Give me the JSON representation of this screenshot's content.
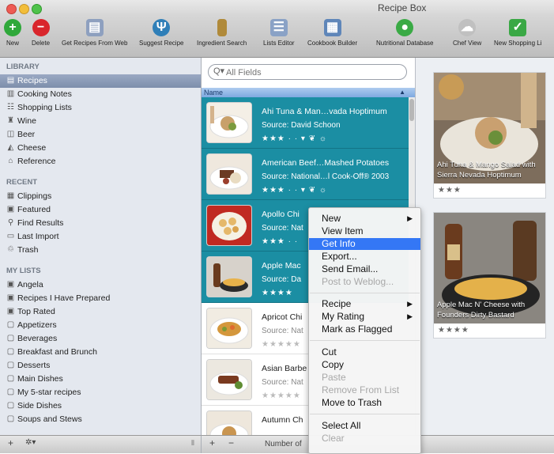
{
  "window": {
    "title": "Recipe Box"
  },
  "toolbar": {
    "items": [
      {
        "label": "New",
        "icon": "plus-circle-icon",
        "color": "#2fa83a"
      },
      {
        "label": "Delete",
        "icon": "minus-circle-icon",
        "color": "#d9262c"
      },
      {
        "label": "Get Recipes From Web",
        "icon": "web-icon",
        "color": "#8ea0bf"
      },
      {
        "label": "Suggest Recipe",
        "icon": "fork-knife-icon",
        "color": "#2f7fb8"
      },
      {
        "label": "Ingredient Search",
        "icon": "bottle-icon",
        "color": "#b08a3a"
      },
      {
        "label": "Lists Editor",
        "icon": "lists-icon",
        "color": "#8aa2c6"
      },
      {
        "label": "Cookbook Builder",
        "icon": "cookbook-icon",
        "color": "#5f86b9"
      },
      {
        "label": "Nutritional Database",
        "icon": "nutrition-icon",
        "color": "#3aaa45"
      },
      {
        "label": "Chef View",
        "icon": "chef-hat-icon",
        "color": "#c0c0c0"
      },
      {
        "label": "New Shopping Li",
        "icon": "shopping-list-icon",
        "color": "#3aa845"
      }
    ]
  },
  "sidebar": {
    "library_title": "LIBRARY",
    "library": [
      {
        "label": "Recipes",
        "icon": "recipes-icon"
      },
      {
        "label": "Cooking Notes",
        "icon": "notes-icon"
      },
      {
        "label": "Shopping Lists",
        "icon": "shopping-icon"
      },
      {
        "label": "Wine",
        "icon": "wine-icon"
      },
      {
        "label": "Beer",
        "icon": "beer-icon"
      },
      {
        "label": "Cheese",
        "icon": "cheese-icon"
      },
      {
        "label": "Reference",
        "icon": "reference-icon"
      }
    ],
    "recent_title": "RECENT",
    "recent": [
      {
        "label": "Clippings",
        "icon": "clippings-icon"
      },
      {
        "label": "Featured",
        "icon": "featured-icon"
      },
      {
        "label": "Find Results",
        "icon": "find-icon"
      },
      {
        "label": "Last Import",
        "icon": "import-icon"
      },
      {
        "label": "Trash",
        "icon": "trash-icon"
      }
    ],
    "mylists_title": "MY LISTS",
    "mylists": [
      {
        "label": "Angela",
        "icon": "smart-list-icon"
      },
      {
        "label": "Recipes I Have Prepared",
        "icon": "smart-list-icon"
      },
      {
        "label": "Top Rated",
        "icon": "smart-list-icon"
      },
      {
        "label": "Appetizers",
        "icon": "list-icon"
      },
      {
        "label": "Beverages",
        "icon": "list-icon"
      },
      {
        "label": "Breakfast and Brunch",
        "icon": "list-icon"
      },
      {
        "label": "Desserts",
        "icon": "list-icon"
      },
      {
        "label": "Main Dishes",
        "icon": "list-icon"
      },
      {
        "label": "My 5-star recipes",
        "icon": "list-icon"
      },
      {
        "label": "Side Dishes",
        "icon": "list-icon"
      },
      {
        "label": "Soups and Stews",
        "icon": "list-icon"
      }
    ],
    "footer": {
      "add": "+",
      "action": "✲▾",
      "resize": "⦀"
    }
  },
  "search": {
    "placeholder": "All Fields",
    "scope": "Q▾"
  },
  "list": {
    "column_name": "Name",
    "rows": [
      {
        "title": "Ahi Tuna & Man…vada Hoptimum",
        "source": "Source: David Schoon",
        "stars": "★★★ · · ▾ ❦ ☼"
      },
      {
        "title": "American Beef…Mashed Potatoes",
        "source": "Source: National…l Cook-Off® 2003",
        "stars": "★★★ · · ▾ ❦ ☼"
      },
      {
        "title": "Apollo Chi",
        "source": "Source: Nat",
        "stars": "★★★ · ·"
      },
      {
        "title": "Apple Mac",
        "source": "Source: Da",
        "stars": "★★★★"
      },
      {
        "title": "Apricot Chi",
        "source": "Source: Nat",
        "stars": "★★★★★"
      },
      {
        "title": "Asian Barbe",
        "source": "Source: Nat",
        "stars": "★★★★★"
      },
      {
        "title": "Autumn Ch",
        "source": "",
        "stars": ""
      }
    ]
  },
  "bottom": {
    "add": "+",
    "remove": "−",
    "status": "Number of"
  },
  "cards": [
    {
      "caption": "Ahi Tuna & Mango Salad with Sierra Nevada Hoptimum",
      "stars": "★★★"
    },
    {
      "caption": "Apple Mac N' Cheese with Founders Dirty Bastard",
      "stars": "★★★★"
    }
  ],
  "context_menu": {
    "items": [
      {
        "label": "New",
        "submenu": true,
        "disabled": false
      },
      {
        "label": "View Item",
        "submenu": false,
        "disabled": false
      },
      {
        "label": "Get Info",
        "submenu": false,
        "disabled": false,
        "highlighted": true
      },
      {
        "label": "Export...",
        "submenu": false,
        "disabled": false
      },
      {
        "label": "Send Email...",
        "submenu": false,
        "disabled": false
      },
      {
        "label": "Post to Weblog...",
        "submenu": false,
        "disabled": true
      },
      {
        "label": "Recipe",
        "submenu": true,
        "disabled": false
      },
      {
        "label": "My Rating",
        "submenu": true,
        "disabled": false
      },
      {
        "label": "Mark as Flagged",
        "submenu": false,
        "disabled": false
      },
      {
        "label": "Cut",
        "submenu": false,
        "disabled": false
      },
      {
        "label": "Copy",
        "submenu": false,
        "disabled": false
      },
      {
        "label": "Paste",
        "submenu": false,
        "disabled": true
      },
      {
        "label": "Remove From List",
        "submenu": false,
        "disabled": true
      },
      {
        "label": "Move to Trash",
        "submenu": false,
        "disabled": false
      },
      {
        "label": "Select All",
        "submenu": false,
        "disabled": false
      },
      {
        "label": "Clear",
        "submenu": false,
        "disabled": true
      }
    ],
    "submenu_arrow": "▶",
    "highlight_color": "#3477f5"
  },
  "colors": {
    "selected_row": "#1b8ea3",
    "sidebar_bg": "#e4e8ef"
  }
}
